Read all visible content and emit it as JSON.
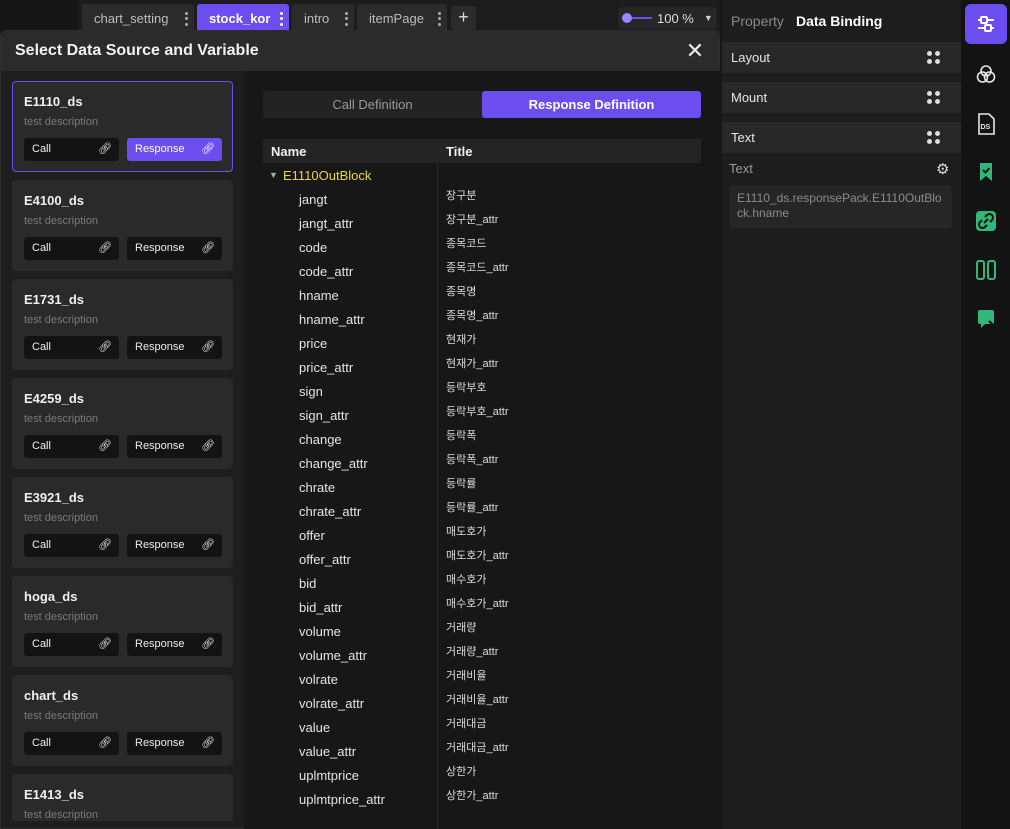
{
  "tabs": [
    {
      "label": "chart_setting"
    },
    {
      "label": "stock_kor"
    },
    {
      "label": "intro"
    },
    {
      "label": "itemPage"
    }
  ],
  "add_tab": "+",
  "zoom": {
    "value": "100 %",
    "level": 1.0
  },
  "modal": {
    "title": "Select Data Source and Variable",
    "close": "✕"
  },
  "data_sources": [
    {
      "name": "E1110_ds",
      "desc": "test description",
      "call": "Call",
      "response": "Response"
    },
    {
      "name": "E4100_ds",
      "desc": "test description",
      "call": "Call",
      "response": "Response"
    },
    {
      "name": "E1731_ds",
      "desc": "test description",
      "call": "Call",
      "response": "Response"
    },
    {
      "name": "E4259_ds",
      "desc": "test description",
      "call": "Call",
      "response": "Response"
    },
    {
      "name": "E3921_ds",
      "desc": "test description",
      "call": "Call",
      "response": "Response"
    },
    {
      "name": "hoga_ds",
      "desc": "test description",
      "call": "Call",
      "response": "Response"
    },
    {
      "name": "chart_ds",
      "desc": "test description",
      "call": "Call",
      "response": "Response"
    },
    {
      "name": "E1413_ds",
      "desc": "test description",
      "call": "Call",
      "response": "Response"
    }
  ],
  "definition_tabs": {
    "call": "Call Definition",
    "response": "Response Definition"
  },
  "grid": {
    "col_name": "Name",
    "col_title": "Title",
    "block": "E1110OutBlock",
    "fields": [
      {
        "name": "jangt",
        "title": "장구분"
      },
      {
        "name": "jangt_attr",
        "title": "장구분_attr"
      },
      {
        "name": "code",
        "title": "종목코드"
      },
      {
        "name": "code_attr",
        "title": "종목코드_attr"
      },
      {
        "name": "hname",
        "title": "종목명"
      },
      {
        "name": "hname_attr",
        "title": "종목명_attr"
      },
      {
        "name": "price",
        "title": "현재가"
      },
      {
        "name": "price_attr",
        "title": "현재가_attr"
      },
      {
        "name": "sign",
        "title": "등락부호"
      },
      {
        "name": "sign_attr",
        "title": "등락부호_attr"
      },
      {
        "name": "change",
        "title": "등락폭"
      },
      {
        "name": "change_attr",
        "title": "등락폭_attr"
      },
      {
        "name": "chrate",
        "title": "등락률"
      },
      {
        "name": "chrate_attr",
        "title": "등락률_attr"
      },
      {
        "name": "offer",
        "title": "매도호가"
      },
      {
        "name": "offer_attr",
        "title": "매도호가_attr"
      },
      {
        "name": "bid",
        "title": "매수호가"
      },
      {
        "name": "bid_attr",
        "title": "매수호가_attr"
      },
      {
        "name": "volume",
        "title": "거래량"
      },
      {
        "name": "volume_attr",
        "title": "거래량_attr"
      },
      {
        "name": "volrate",
        "title": "거래비율"
      },
      {
        "name": "volrate_attr",
        "title": "거래비율_attr"
      },
      {
        "name": "value",
        "title": "거래대금"
      },
      {
        "name": "value_attr",
        "title": "거래대금_attr"
      },
      {
        "name": "uplmtprice",
        "title": "상한가"
      },
      {
        "name": "uplmtprice_attr",
        "title": "상한가_attr"
      }
    ]
  },
  "property_panel": {
    "tab_property": "Property",
    "tab_binding": "Data Binding",
    "sections": [
      "Layout",
      "Mount",
      "Text"
    ],
    "text_label": "Text",
    "binding_value": "E1110_ds.responsePack.E1110OutBlock.hname"
  },
  "rail_icons": [
    "sliders-icon",
    "circles-icon",
    "ds-file-icon",
    "bookmark-check-icon",
    "link-icon",
    "columns-icon",
    "chat-icon"
  ],
  "colors": {
    "accent": "#6b4ef0",
    "block_name": "#e8d83a",
    "rail_green": "#2fb877"
  }
}
